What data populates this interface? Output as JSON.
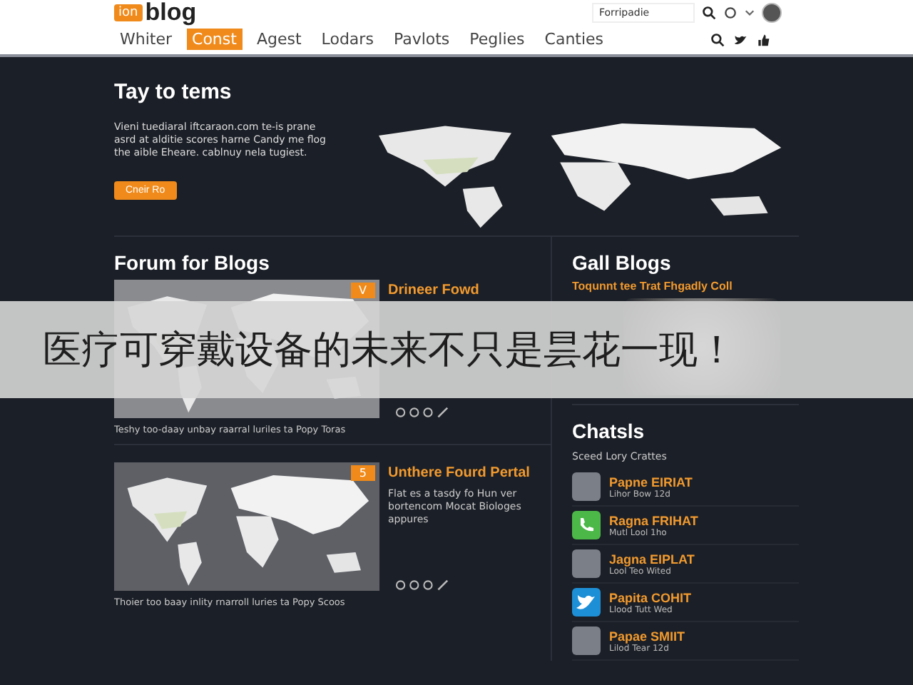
{
  "header": {
    "logo_badge": "ion",
    "logo_text": "blog",
    "search": {
      "placeholder": "Forripadie"
    }
  },
  "nav": [
    {
      "label": "Whiter",
      "selected": false
    },
    {
      "label": "Const",
      "selected": true
    },
    {
      "label": "Agest",
      "selected": false
    },
    {
      "label": "Lodars",
      "selected": false
    },
    {
      "label": "Pavlots",
      "selected": false
    },
    {
      "label": "Peglies",
      "selected": false
    },
    {
      "label": "Canties",
      "selected": false
    }
  ],
  "hero": {
    "title": "Tay to tems",
    "text": "Vieni tuediaral iftcaraon.com te-is prane asrd at alditie scores harne Candy me flog the aible Eheare. cablnuy nela tugiest.",
    "button": "Cneir Ro"
  },
  "forum": {
    "title": "Forum for Blogs",
    "cards": [
      {
        "badge": "V",
        "title": "Drineer Fowd",
        "caption": "Teshy too-daay unbay raarral luriles ta Popy Toras"
      },
      {
        "badge": "5",
        "title": "Unthere Fourd Pertal",
        "text": "Flat es a tasdy fo Hun ver bortencom Mocat Biologes appures",
        "caption": "Thoier too baay inlity rnarroll luries ta Popy Scoos"
      }
    ]
  },
  "gallery": {
    "title": "Gall Blogs",
    "subtitle": "Toqunnt tee Trat Fhgadly Coll"
  },
  "chats": {
    "title": "Chatsls",
    "subtitle": "Sceed Lory Crattes",
    "items": [
      {
        "kind": "photo",
        "name": "Papne EIRIAT",
        "meta": "Lihor Bow 12d"
      },
      {
        "kind": "phone",
        "name": "Ragna FRIHAT",
        "meta": "Mutl Lool 1ho"
      },
      {
        "kind": "photo",
        "name": "Jagna EIPLAT",
        "meta": "Lool Teo Wited"
      },
      {
        "kind": "bird",
        "name": "Papita COHIT",
        "meta": "Llood Tutt Wed"
      },
      {
        "kind": "photo",
        "name": "Papae SMIIT",
        "meta": "Lilod Tear 12d"
      }
    ]
  },
  "banner": "医疗可穿戴设备的未来不只是昙花一现！"
}
